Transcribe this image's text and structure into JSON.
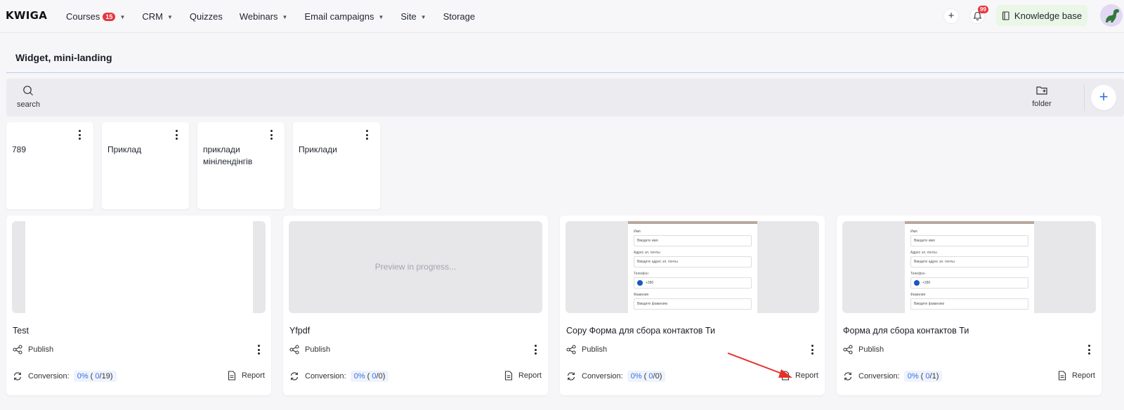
{
  "app": {
    "logo": "KWIGA"
  },
  "nav": {
    "items": [
      {
        "label": "Courses",
        "badge": "15",
        "dropdown": true
      },
      {
        "label": "CRM",
        "dropdown": true
      },
      {
        "label": "Quizzes",
        "dropdown": false
      },
      {
        "label": "Webinars",
        "dropdown": true
      },
      {
        "label": "Email campaigns",
        "dropdown": true
      },
      {
        "label": "Site",
        "dropdown": true
      },
      {
        "label": "Storage",
        "dropdown": false
      }
    ],
    "notifications_count": "99",
    "knowledge_base_label": "Knowledge base"
  },
  "page": {
    "title": "Widget, mini-landing"
  },
  "toolbar": {
    "search_label": "search",
    "folder_label": "folder",
    "add_symbol": "+"
  },
  "folders": [
    {
      "name": "789"
    },
    {
      "name": "Приклад"
    },
    {
      "name": "приклади мінілендінгів"
    },
    {
      "name": "Приклади"
    }
  ],
  "form_preview": {
    "name_label": "Имя",
    "name_placeholder": "Введите имя",
    "email_label": "Адрес эл. почты",
    "email_placeholder": "Введите адрес эл. почты",
    "phone_label": "Телефон",
    "phone_code": "+380",
    "surname_label": "Фамилия",
    "surname_placeholder": "Введите фамилию"
  },
  "widgets": [
    {
      "title": "Test",
      "preview": "blank",
      "publish_label": "Publish",
      "conversion_label": "Conversion:",
      "conv_pct": "0%",
      "conv_done": "0",
      "conv_total": "19",
      "report_label": "Report"
    },
    {
      "title": "Yfpdf",
      "preview": "in-progress",
      "preview_text": "Preview in progress...",
      "publish_label": "Publish",
      "conversion_label": "Conversion:",
      "conv_pct": "0%",
      "conv_done": "0",
      "conv_total": "0",
      "report_label": "Report"
    },
    {
      "title": "Copy Форма для сбора контактов Ти",
      "preview": "form",
      "publish_label": "Publish",
      "conversion_label": "Conversion:",
      "conv_pct": "0%",
      "conv_done": "0",
      "conv_total": "0",
      "report_label": "Report"
    },
    {
      "title": "Форма для сбора контактов Ти",
      "preview": "form",
      "publish_label": "Publish",
      "conversion_label": "Conversion:",
      "conv_pct": "0%",
      "conv_done": "0",
      "conv_total": "1",
      "report_label": "Report"
    }
  ],
  "colors": {
    "accent": "#3a6fe0",
    "badge": "#e8343d",
    "kb_bg": "#eaf6e6",
    "arrow": "#e8302a"
  }
}
